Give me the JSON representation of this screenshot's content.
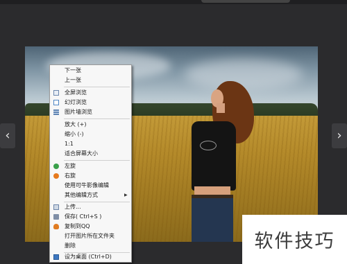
{
  "window": {
    "title": ""
  },
  "navigation": {
    "prev_glyph": "‹",
    "next_glyph": "›"
  },
  "context_menu": {
    "items": [
      {
        "label": "下一张",
        "icon": ""
      },
      {
        "label": "上一张",
        "icon": ""
      },
      {
        "label": "全屏浏览",
        "icon": "fullscreen-icon"
      },
      {
        "label": "幻灯浏览",
        "icon": "slideshow-icon"
      },
      {
        "label": "图片墙浏览",
        "icon": "photo-wall-icon"
      },
      {
        "label": "放大 (+)",
        "icon": ""
      },
      {
        "label": "缩小 (-)",
        "icon": ""
      },
      {
        "label": "1:1",
        "icon": ""
      },
      {
        "label": "适合屏幕大小",
        "icon": ""
      },
      {
        "label": "左旋",
        "icon": "rotate-left-icon"
      },
      {
        "label": "右旋",
        "icon": "rotate-right-icon"
      },
      {
        "label": "使用可牛影像编辑",
        "icon": ""
      },
      {
        "label": "其他编辑方式",
        "icon": "",
        "submenu": true
      },
      {
        "label": "上传...",
        "icon": "upload-icon"
      },
      {
        "label": "保存( Ctrl+S )",
        "icon": "save-icon"
      },
      {
        "label": "复制到QQ",
        "icon": "qq-icon"
      },
      {
        "label": "打开图片所在文件夹",
        "icon": ""
      },
      {
        "label": "删除",
        "icon": ""
      },
      {
        "label": "设为桌面      (Ctrl+D)",
        "icon": "desktop-icon"
      }
    ]
  },
  "watermark": {
    "text": "软件技巧"
  },
  "colors": {
    "background": "#2b2b2d",
    "menu_bg": "#f7f7f7",
    "menu_border": "#9a9a9a"
  }
}
